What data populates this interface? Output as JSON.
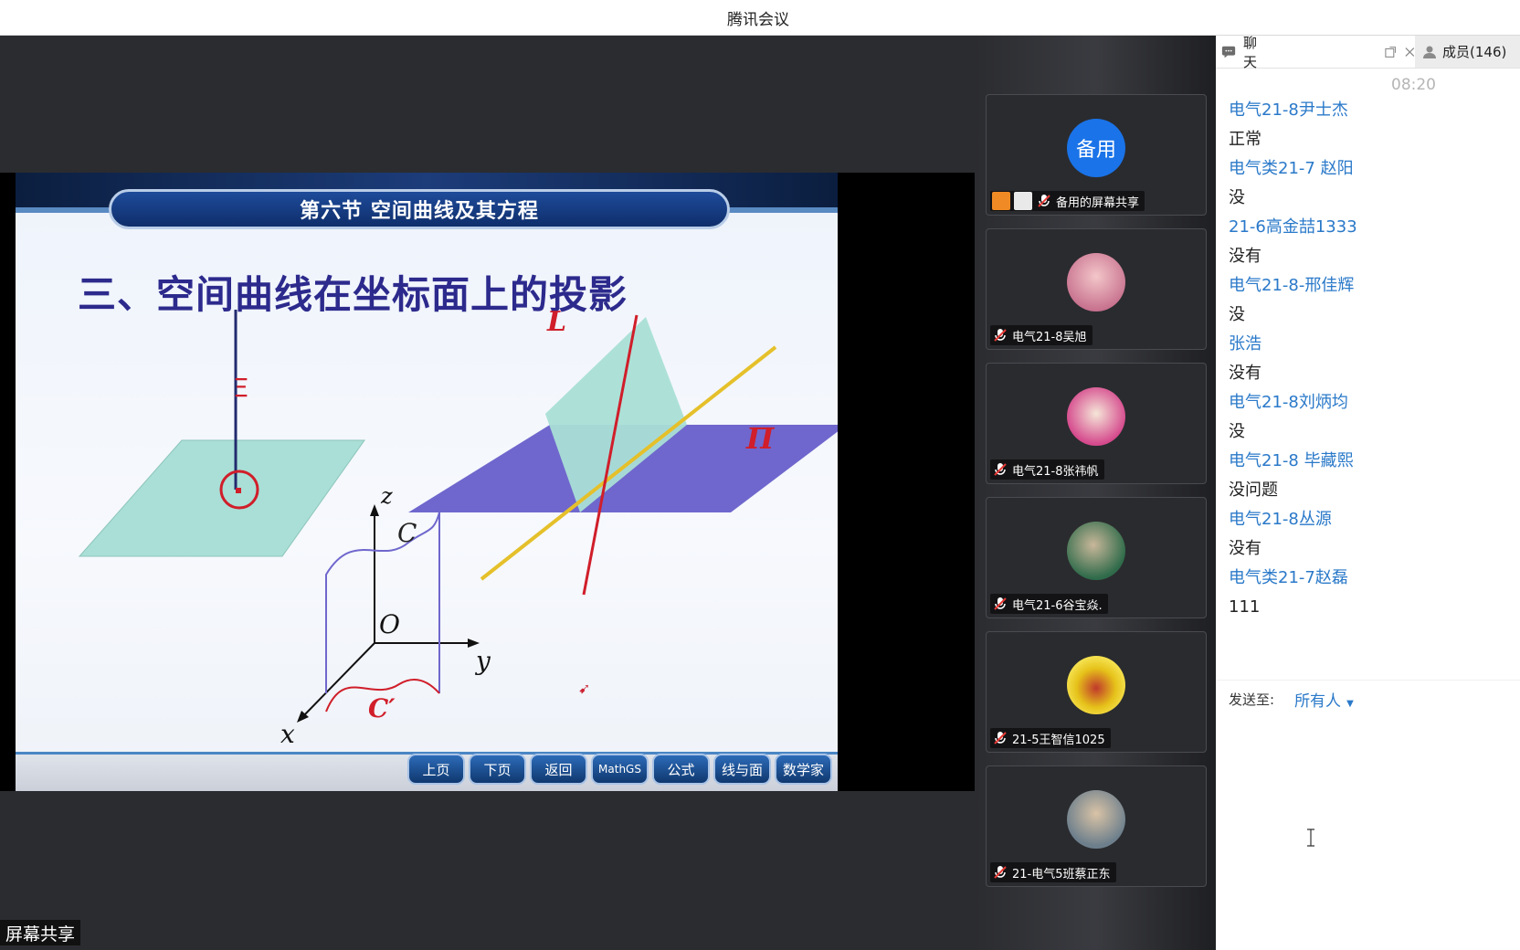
{
  "window": {
    "title": "腾讯会议"
  },
  "share": {
    "label": "屏幕共享",
    "slide": {
      "section_title": "第六节  空间曲线及其方程",
      "heading": "三、空间曲线在坐标面上的投影",
      "figure_labels": {
        "L": "L",
        "Pi": "Π",
        "z": "z",
        "C": "C",
        "O": "O",
        "y": "y",
        "x": "x",
        "C_prime": "C′"
      },
      "nav_buttons": [
        "上页",
        "下页",
        "返回",
        "MathGS",
        "公式",
        "线与面",
        "数学家"
      ]
    }
  },
  "participants": [
    {
      "name": "备用的屏幕共享",
      "avatar_text": "备用",
      "avatar_color": "#1a73e8",
      "sharing": true
    },
    {
      "name": "电气21-8吴旭",
      "avatar_color": "#b8547a"
    },
    {
      "name": "电气21-8张祎帆",
      "avatar_color": "#d54a8d"
    },
    {
      "name": "电气21-6谷宝焱.",
      "avatar_color": "#2f6b4a"
    },
    {
      "name": "21-5王智信1025",
      "avatar_color": "#e6c21a"
    },
    {
      "name": "21-电气5班蔡正东",
      "avatar_color": "#6d7f8c"
    }
  ],
  "chat": {
    "tab_chat": "聊天",
    "tab_members": "成员(146)",
    "time": "08:20",
    "messages": [
      {
        "sender": "电气21-8尹士杰",
        "text": "正常"
      },
      {
        "sender": "电气类21-7 赵阳",
        "text": "没"
      },
      {
        "sender": "21-6高金喆1333",
        "text": "没有"
      },
      {
        "sender": "电气21-8-邢佳辉",
        "text": "没"
      },
      {
        "sender": "张浩",
        "text": "没有"
      },
      {
        "sender": "电气21-8刘炳均",
        "text": "没"
      },
      {
        "sender": "电气21-8 毕藏熙",
        "text": "没问题"
      },
      {
        "sender": "电气21-8丛源",
        "text": "没有"
      },
      {
        "sender": "电气类21-7赵磊",
        "text": "111"
      }
    ],
    "send_to_label": "发送至:",
    "send_to_value": "所有人"
  }
}
